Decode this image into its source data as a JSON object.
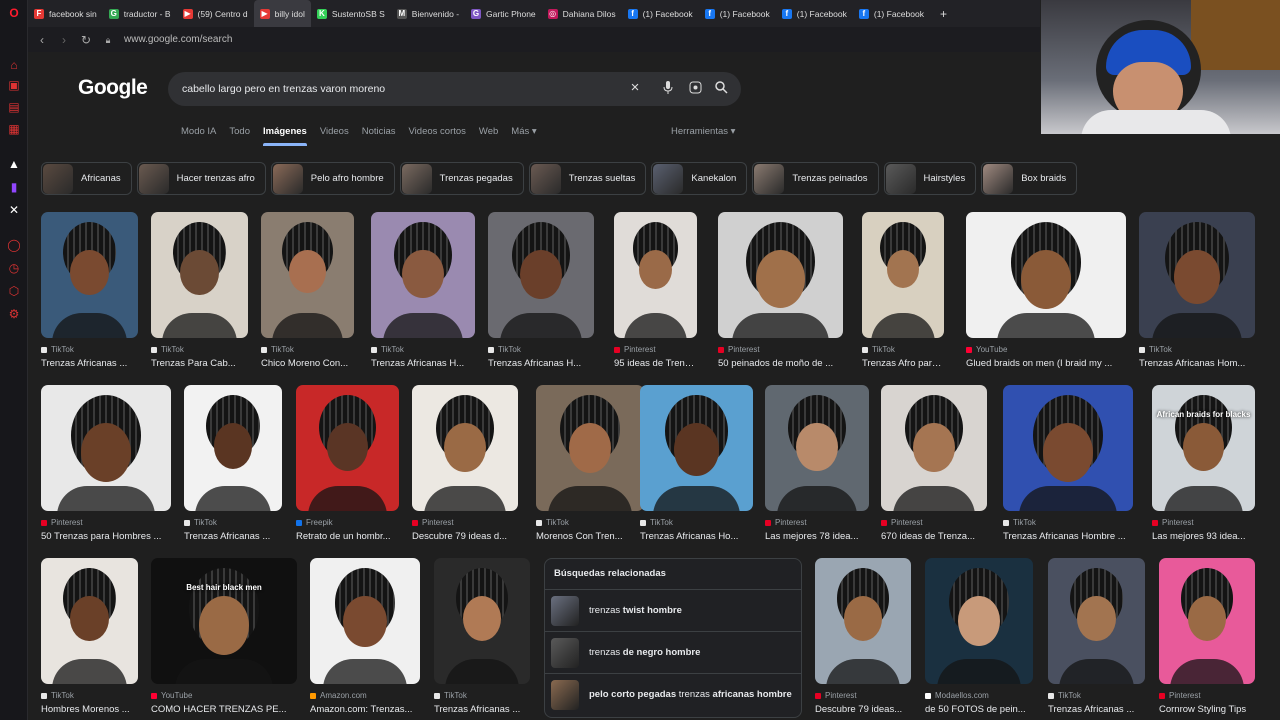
{
  "tabs": [
    {
      "label": "facebook sin",
      "color": "#e53935",
      "icon": "F"
    },
    {
      "label": "traductor - B",
      "color": "#34a853",
      "icon": "G"
    },
    {
      "label": "(59) Centro d",
      "color": "#e53935",
      "icon": "▶"
    },
    {
      "label": "billy idol",
      "color": "#e53935",
      "icon": "▶"
    },
    {
      "label": "SustentoSB S",
      "color": "#34d058",
      "icon": "K"
    },
    {
      "label": "Bienvenido -",
      "color": "#555",
      "icon": "M"
    },
    {
      "label": "Gartic Phone",
      "color": "#7e57c2",
      "icon": "G"
    },
    {
      "label": "Dahiana Dilos",
      "color": "#c2185b",
      "icon": "◎"
    },
    {
      "label": "(1) Facebook",
      "color": "#1877f2",
      "icon": "f"
    },
    {
      "label": "(1) Facebook",
      "color": "#1877f2",
      "icon": "f"
    },
    {
      "label": "(1) Facebook",
      "color": "#1877f2",
      "icon": "f"
    },
    {
      "label": "(1) Facebook",
      "color": "#1877f2",
      "icon": "f"
    }
  ],
  "url": "www.google.com/search",
  "logo": "Google",
  "search": {
    "query": "cabello largo pero en trenzas varon moreno"
  },
  "nav": {
    "items": [
      "Modo IA",
      "Todo",
      "Imágenes",
      "Videos",
      "Noticias",
      "Videos cortos",
      "Web",
      "Más ▾"
    ],
    "active": "Imágenes",
    "tools": "Herramientas ▾"
  },
  "chips": [
    "Africanas",
    "Hacer trenzas afro",
    "Pelo afro hombre",
    "Trenzas pegadas",
    "Trenzas sueltas",
    "Kanekalon",
    "Trenzas peinados",
    "Hairstyles",
    "Box braids"
  ],
  "results": [
    {
      "source": "TikTok",
      "title": "Trenzas Africanas ...",
      "bg": "#3a5a7a",
      "skin": "#7a4a30"
    },
    {
      "source": "TikTok",
      "title": "Trenzas Para Cab...",
      "bg": "#d8d2c8",
      "skin": "#6b4a35"
    },
    {
      "source": "TikTok",
      "title": "Chico Moreno Con...",
      "bg": "#8a7d70",
      "skin": "#a86f50"
    },
    {
      "source": "TikTok",
      "title": "Trenzas Africanas H...",
      "bg": "#9a8ab0",
      "skin": "#8a5a40"
    },
    {
      "source": "TikTok",
      "title": "Trenzas Africanas H...",
      "bg": "#6a6a70",
      "skin": "#6a3f2a"
    },
    {
      "source": "Pinterest",
      "title": "95 ideas de Trenza...",
      "bg": "#e0dcd8",
      "skin": "#9a6a48"
    },
    {
      "source": "Pinterest",
      "title": "50 peinados de moño de ...",
      "bg": "#d0d0d0",
      "skin": "#a0704a"
    },
    {
      "source": "TikTok",
      "title": "Trenzas Afro para ...",
      "bg": "#d8d0c0",
      "skin": "#a27450"
    },
    {
      "source": "YouTube",
      "title": "Glued braids on men (I braid my ...",
      "bg": "#f0f0f0",
      "skin": "#8a5a38"
    },
    {
      "source": "TikTok",
      "title": "Trenzas Africanas Hom...",
      "bg": "#3a4050",
      "skin": "#7a4a30"
    },
    {
      "source": "Pinterest",
      "title": "50 Trenzas para Hombres ...",
      "bg": "#e8e8e8",
      "skin": "#6a4028"
    },
    {
      "source": "TikTok",
      "title": "Trenzas Africanas ...",
      "bg": "#f2f2f2",
      "skin": "#5a3522"
    },
    {
      "source": "Freepik",
      "title": "Retrato de un hombr...",
      "bg": "#c82828",
      "skin": "#5a3525"
    },
    {
      "source": "Pinterest",
      "title": "Descubre 79 ideas d...",
      "bg": "#ece8e2",
      "skin": "#9a6a45"
    },
    {
      "source": "TikTok",
      "title": "Morenos Con Tren...",
      "bg": "#7a6a5a",
      "skin": "#a06a48"
    },
    {
      "source": "TikTok",
      "title": "Trenzas Africanas Ho...",
      "bg": "#5aa0d0",
      "skin": "#5a3522"
    },
    {
      "source": "Pinterest",
      "title": "Las mejores 78 idea...",
      "bg": "#606870",
      "skin": "#b88a6a"
    },
    {
      "source": "Pinterest",
      "title": "670 ideas de Trenza...",
      "bg": "#d8d4d0",
      "skin": "#a57552"
    },
    {
      "source": "TikTok",
      "title": "Trenzas Africanas Hombre ...",
      "bg": "#3050b0",
      "skin": "#7a4a30"
    },
    {
      "source": "Pinterest",
      "title": "Las mejores 93 idea...",
      "bg": "#cfd4d8",
      "skin": "#8a5a38"
    },
    {
      "source": "TikTok",
      "title": "Hombres Morenos ...",
      "bg": "#e8e4df",
      "skin": "#6a4028"
    },
    {
      "source": "YouTube",
      "title": "COMO HACER TRENZAS PE...",
      "bg": "#101010",
      "skin": "#9a6a45"
    },
    {
      "source": "Amazon.com",
      "title": "Amazon.com: Trenzas...",
      "bg": "#f0f0f0",
      "skin": "#7a4a30"
    },
    {
      "source": "TikTok",
      "title": "Trenzas Africanas ...",
      "bg": "#2a2a2a",
      "skin": "#b07a55"
    },
    {
      "source": "Pinterest",
      "title": "Descubre 79 ideas...",
      "bg": "#9aa6b2",
      "skin": "#9a6a45"
    },
    {
      "source": "Modaellos.com",
      "title": "de 50 FOTOS de pein...",
      "bg": "#1a3040",
      "skin": "#c89a7a"
    },
    {
      "source": "TikTok",
      "title": "Trenzas Africanas ...",
      "bg": "#4a5060",
      "skin": "#a27450"
    },
    {
      "source": "Pinterest",
      "title": "Cornrow Styling Tips",
      "bg": "#e85a9a",
      "skin": "#9a6a45"
    }
  ],
  "overlays": {
    "result_19": "African braids for blacks",
    "result_21": "Best hair black men"
  },
  "related": {
    "heading": "Búsquedas relacionadas",
    "items": [
      {
        "pre": "trenzas ",
        "bold": "twist hombre",
        "post": ""
      },
      {
        "pre": "trenzas ",
        "bold": "de negro hombre",
        "post": ""
      },
      {
        "pre": "",
        "bold": "pelo corto pegadas",
        "post": " trenzas ",
        "bold2": "africanas hombre"
      }
    ]
  },
  "source_colors": {
    "TikTok": "#e8e8e8",
    "Pinterest": "#e60023",
    "YouTube": "#ff0033",
    "Freepik": "#1273eb",
    "Amazon.com": "#ff9900",
    "Modaellos.com": "#ffffff"
  }
}
